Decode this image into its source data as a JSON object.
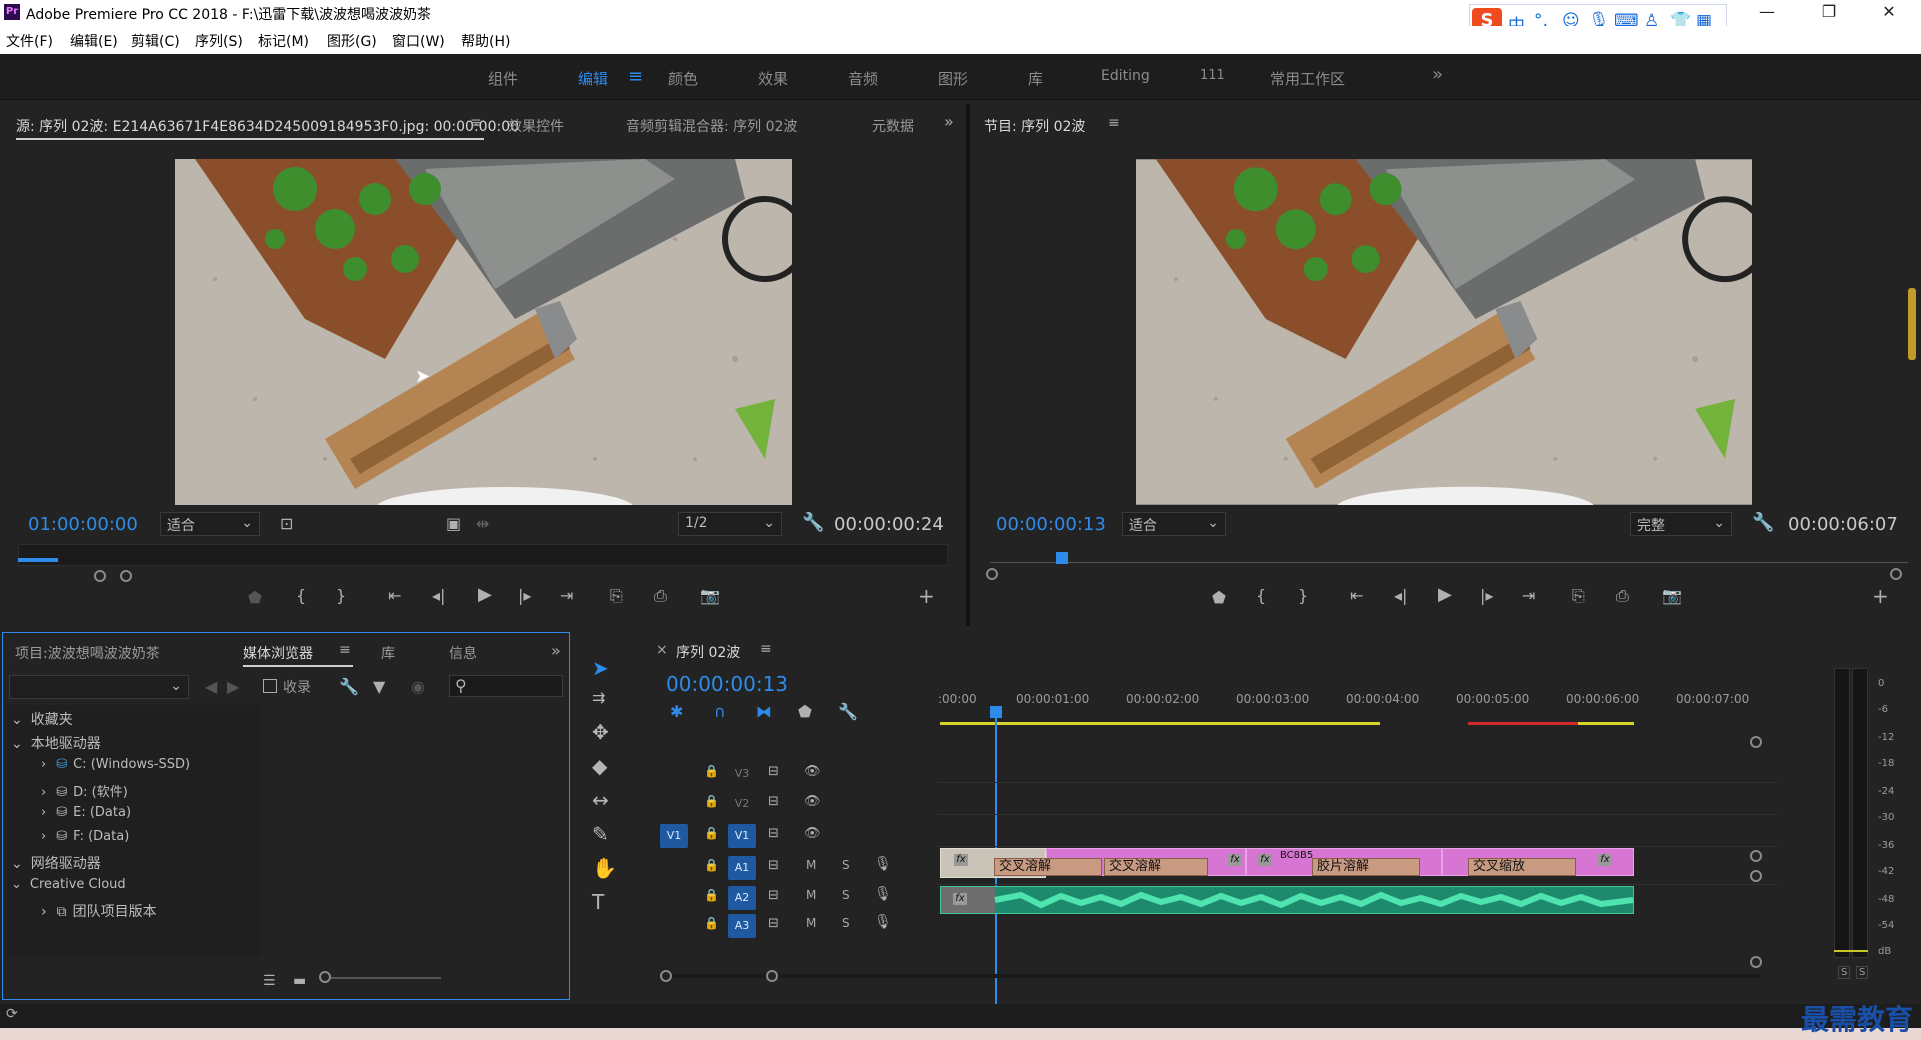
{
  "window": {
    "title": "Adobe Premiere Pro CC 2018 - F:\\迅雷下载\\波波想喝波波奶茶",
    "logo": "Pr",
    "controls": [
      "minimize-icon",
      "restore-icon",
      "close-icon"
    ]
  },
  "menu": [
    "文件(F)",
    "编辑(E)",
    "剪辑(C)",
    "序列(S)",
    "标记(M)",
    "图形(G)",
    "窗口(W)",
    "帮助(H)"
  ],
  "ime": {
    "label": "中",
    "logo": "S",
    "icons": [
      "punct-icon",
      "emoji-icon",
      "mic-icon",
      "keyboard-icon",
      "user-icon",
      "shirt-icon",
      "grid-icon"
    ]
  },
  "workspaces": {
    "items": [
      "组件",
      "编辑",
      "颜色",
      "效果",
      "音频",
      "图形",
      "库",
      "Editing",
      "111",
      "常用工作区"
    ],
    "active": "编辑",
    "more": "»"
  },
  "source": {
    "tabs": [
      "源: 序列 02波: E214A63671F4E8634D245009184953F0.jpg: 00:00:00:00",
      "效果控件",
      "音频剪辑混合器: 序列 02波",
      "元数据"
    ],
    "timecode": "01:00:00:00",
    "fit": "适合",
    "resolution": "1/2",
    "duration": "00:00:00:24"
  },
  "program": {
    "tab": "节目: 序列 02波",
    "timecode": "00:00:00:13",
    "fit": "适合",
    "quality": "完整",
    "duration": "00:00:06:07"
  },
  "project": {
    "tabs": [
      "项目:波波想喝波波奶茶",
      "媒体浏览器",
      "库",
      "信息"
    ],
    "active_tab": "媒体浏览器",
    "ingest": "收录",
    "tree": [
      {
        "label": "收藏夹",
        "level": 0
      },
      {
        "label": "本地驱动器",
        "level": 0
      },
      {
        "label": "C: (Windows-SSD)",
        "level": 1
      },
      {
        "label": "D: (软件)",
        "level": 1
      },
      {
        "label": "E: (Data)",
        "level": 1
      },
      {
        "label": "F: (Data)",
        "level": 1
      },
      {
        "label": "网络驱动器",
        "level": 0
      },
      {
        "label": "Creative Cloud",
        "level": 0
      },
      {
        "label": "团队项目版本",
        "level": 1
      }
    ]
  },
  "timeline": {
    "tab": "序列 02波",
    "timecode": "00:00:00:13",
    "ruler": [
      ":00:00",
      "00:00:01:00",
      "00:00:02:00",
      "00:00:03:00",
      "00:00:04:00",
      "00:00:05:00",
      "00:00:06:00",
      "00:00:07:00"
    ],
    "video_tracks": [
      "V3",
      "V2",
      "V1"
    ],
    "audio_tracks": [
      "A1",
      "A2",
      "A3"
    ],
    "source_patch": "V1",
    "transitions": [
      "交叉溶解",
      "交叉溶解",
      "胶片溶解",
      "交叉缩放"
    ],
    "clip_label": "BC8B5",
    "mute": "M",
    "solo": "S"
  },
  "meter": {
    "scale": [
      "0",
      "-6",
      "-12",
      "-18",
      "-24",
      "-30",
      "-36",
      "-42",
      "-48",
      "-54",
      "dB"
    ],
    "solo": [
      "S",
      "S"
    ]
  },
  "watermark": "最需教育"
}
